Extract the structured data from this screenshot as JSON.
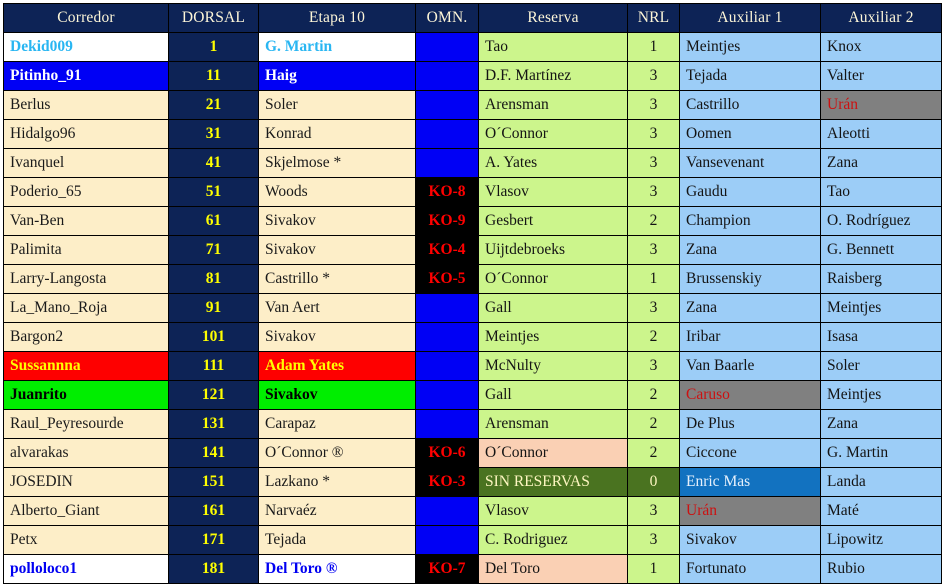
{
  "table": {
    "columns": [
      {
        "key": "corredor",
        "label": "Corredor"
      },
      {
        "key": "dorsal",
        "label": "DORSAL"
      },
      {
        "key": "etapa",
        "label": "Etapa 10"
      },
      {
        "key": "omn",
        "label": "OMN."
      },
      {
        "key": "reserva",
        "label": "Reserva"
      },
      {
        "key": "nrl",
        "label": "NRL"
      },
      {
        "key": "aux1",
        "label": "Auxiliar 1"
      },
      {
        "key": "aux2",
        "label": "Auxiliar 2"
      }
    ],
    "rows": [
      {
        "corredor": "Dekid009",
        "dorsal": "1",
        "etapa": "G. Martin",
        "omn": "",
        "reserva": "Tao",
        "nrl": "1",
        "aux1": "Meintjes",
        "aux2": "Knox"
      },
      {
        "corredor": "Pitinho_91",
        "dorsal": "11",
        "etapa": "Haig",
        "omn": "",
        "reserva": "D.F. Martínez",
        "nrl": "3",
        "aux1": "Tejada",
        "aux2": "Valter"
      },
      {
        "corredor": "Berlus",
        "dorsal": "21",
        "etapa": "Soler",
        "omn": "",
        "reserva": "Arensman",
        "nrl": "3",
        "aux1": "Castrillo",
        "aux2": "Urán"
      },
      {
        "corredor": "Hidalgo96",
        "dorsal": "31",
        "etapa": "Konrad",
        "omn": "",
        "reserva": "O´Connor",
        "nrl": "3",
        "aux1": "Oomen",
        "aux2": "Aleotti"
      },
      {
        "corredor": "Ivanquel",
        "dorsal": "41",
        "etapa": "Skjelmose *",
        "omn": "",
        "reserva": "A. Yates",
        "nrl": "3",
        "aux1": "Vansevenant",
        "aux2": "Zana"
      },
      {
        "corredor": "Poderio_65",
        "dorsal": "51",
        "etapa": "Woods",
        "omn": "KO-8",
        "reserva": "Vlasov",
        "nrl": "3",
        "aux1": "Gaudu",
        "aux2": "Tao"
      },
      {
        "corredor": "Van-Ben",
        "dorsal": "61",
        "etapa": "Sivakov",
        "omn": "KO-9",
        "reserva": "Gesbert",
        "nrl": "2",
        "aux1": "Champion",
        "aux2": "O. Rodríguez"
      },
      {
        "corredor": "Palimita",
        "dorsal": "71",
        "etapa": "Sivakov",
        "omn": "KO-4",
        "reserva": "Uijtdebroeks",
        "nrl": "3",
        "aux1": "Zana",
        "aux2": "G. Bennett"
      },
      {
        "corredor": "Larry-Langosta",
        "dorsal": "81",
        "etapa": "Castrillo *",
        "omn": "KO-5",
        "reserva": "O´Connor",
        "nrl": "1",
        "aux1": "Brussenskiy",
        "aux2": "Raisberg"
      },
      {
        "corredor": "La_Mano_Roja",
        "dorsal": "91",
        "etapa": "Van Aert",
        "omn": "",
        "reserva": "Gall",
        "nrl": "3",
        "aux1": "Zana",
        "aux2": "Meintjes"
      },
      {
        "corredor": "Bargon2",
        "dorsal": "101",
        "etapa": "Sivakov",
        "omn": "",
        "reserva": "Meintjes",
        "nrl": "2",
        "aux1": "Iribar",
        "aux2": "Isasa"
      },
      {
        "corredor": "Sussannna",
        "dorsal": "111",
        "etapa": "Adam Yates",
        "omn": "",
        "reserva": "McNulty",
        "nrl": "3",
        "aux1": "Van Baarle",
        "aux2": "Soler"
      },
      {
        "corredor": "Juanrito",
        "dorsal": "121",
        "etapa": "Sivakov",
        "omn": "",
        "reserva": "Gall",
        "nrl": "2",
        "aux1": "Caruso",
        "aux2": "Meintjes"
      },
      {
        "corredor": "Raul_Peyresourde",
        "dorsal": "131",
        "etapa": "Carapaz",
        "omn": "",
        "reserva": "Arensman",
        "nrl": "2",
        "aux1": "De Plus",
        "aux2": "Zana"
      },
      {
        "corredor": "alvarakas",
        "dorsal": "141",
        "etapa": "O´Connor  ®",
        "omn": "KO-6",
        "reserva": "O´Connor",
        "nrl": "2",
        "aux1": "Ciccone",
        "aux2": "G. Martin"
      },
      {
        "corredor": "JOSEDIN",
        "dorsal": "151",
        "etapa": "Lazkano *",
        "omn": "KO-3",
        "reserva": "SIN RESERVAS",
        "nrl": "0",
        "aux1": "Enric Mas",
        "aux2": "Landa"
      },
      {
        "corredor": "Alberto_Giant",
        "dorsal": "161",
        "etapa": "Narvaéz",
        "omn": "",
        "reserva": "Vlasov",
        "nrl": "3",
        "aux1": "Urán",
        "aux2": "Maté"
      },
      {
        "corredor": "Petx",
        "dorsal": "171",
        "etapa": "Tejada",
        "omn": "",
        "reserva": "C.  Rodriguez",
        "nrl": "3",
        "aux1": "Sivakov",
        "aux2": "Lipowitz"
      },
      {
        "corredor": "polloloco1",
        "dorsal": "181",
        "etapa": "Del Toro ®",
        "omn": "KO-7",
        "reserva": "Del Toro",
        "nrl": "1",
        "aux1": "Fortunato",
        "aux2": "Rubio"
      }
    ],
    "styles": [
      {
        "corredor": "v-white v-cyantext",
        "etapa": "v-white v-cyantext"
      },
      {
        "corredor": "v-blue",
        "etapa": "v-blue"
      },
      {
        "aux2": "v-gray"
      },
      {},
      {},
      {
        "omn": "v-ko"
      },
      {
        "omn": "v-ko"
      },
      {
        "omn": "v-ko"
      },
      {
        "omn": "v-ko"
      },
      {},
      {},
      {
        "corredor": "v-red",
        "etapa": "v-red"
      },
      {
        "corredor": "v-green",
        "etapa": "v-green",
        "aux1": "v-gray"
      },
      {},
      {
        "omn": "v-ko",
        "reserva": "v-peach"
      },
      {
        "omn": "v-ko",
        "reserva": "v-olive",
        "nrl": "v-olivedark",
        "aux1": "v-medblue"
      },
      {
        "aux1": "v-gray"
      },
      {},
      {
        "corredor": "v-white v-bluetext",
        "etapa": "v-white v-bluetext",
        "omn": "v-ko",
        "reserva": "v-peach"
      }
    ]
  },
  "colors": {
    "header_bg": "#0d2356",
    "header_text": "#fdf6d8",
    "cream": "#fdeec8",
    "dorsal_bg": "#0d2356",
    "dorsal_text": "#ffff00",
    "omn_bg": "#0000f5",
    "reserva_bg": "#ccf58c",
    "aux_bg": "#9ccdf7",
    "ko_bg": "#000000",
    "ko_text": "#ff0000",
    "gray_bg": "#808080",
    "peach_bg": "#fad0b4",
    "olive_bg": "#4a7320",
    "medblue_bg": "#1272c0",
    "red_row": "#fe0000",
    "green_row": "#00ee00",
    "blue_row": "#0000f5"
  }
}
